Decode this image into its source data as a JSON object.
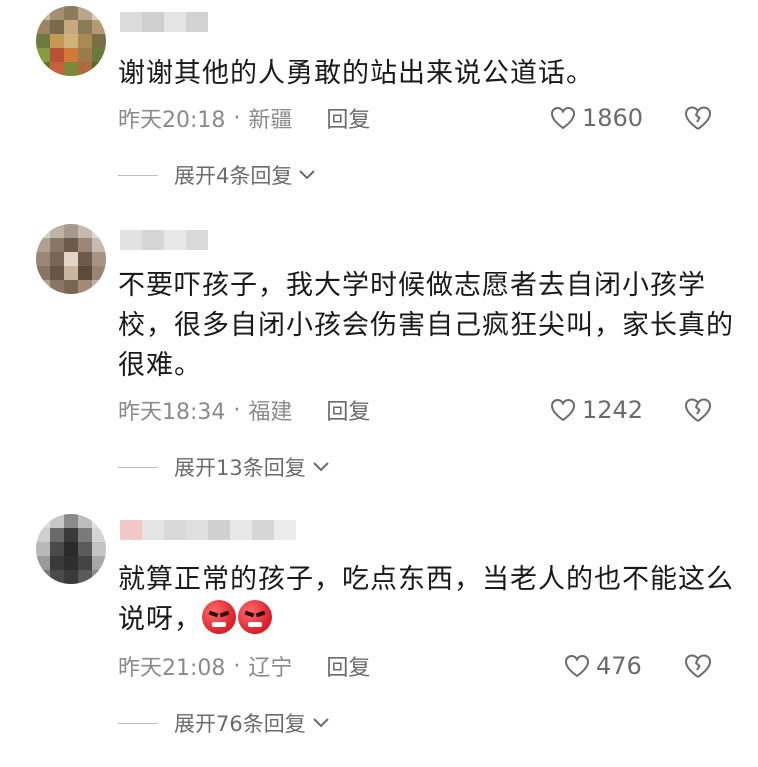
{
  "comments": [
    {
      "text": "谢谢其他的人勇敢的站出来说公道话。",
      "time": "昨天20:18",
      "separator": "·",
      "location": "新疆",
      "reply_label": "回复",
      "likes": "1860",
      "expand_label": "展开4条回复"
    },
    {
      "text": "不要吓孩子，我大学时候做志愿者去自闭小孩学校，很多自闭小孩会伤害自己疯狂尖叫，家长真的很难。",
      "time": "昨天18:34",
      "separator": "·",
      "location": "福建",
      "reply_label": "回复",
      "likes": "1242",
      "expand_label": "展开13条回复"
    },
    {
      "text": "就算正常的孩子，吃点东西，当老人的也不能这么说呀，",
      "time": "昨天21:08",
      "separator": "·",
      "location": "辽宁",
      "reply_label": "回复",
      "likes": "476",
      "expand_label": "展开76条回复",
      "emoji": [
        "angry-face",
        "angry-face"
      ]
    }
  ],
  "colors": {
    "text": "#1a1a1a",
    "meta": "#8a8a8a",
    "icon": "#6b6b6b"
  }
}
